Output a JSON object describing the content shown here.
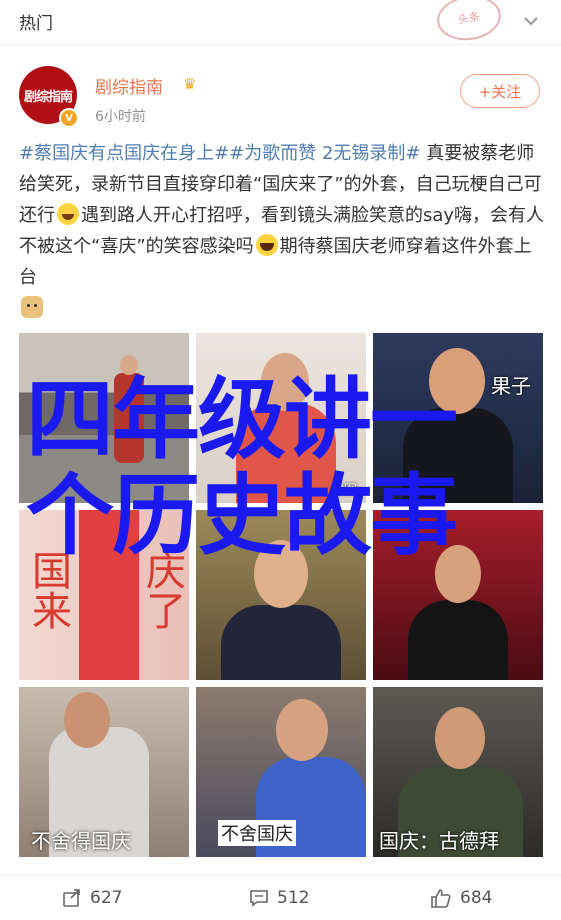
{
  "header": {
    "title": "热门",
    "stamp_text": "头条"
  },
  "author": {
    "name": "剧综指南",
    "avatar_text": "剧综指南",
    "time": "6小时前",
    "follow_label": "+关注",
    "verified_mark": "V"
  },
  "post": {
    "tag1": "#蔡国庆有点国庆在身上#",
    "tag2": "#为歌而赞 2无锡录制#",
    "text1": " 真要被蔡老师给笑死，录新节目直接穿印着“国庆来了”的外套，自己玩梗自己可还行",
    "text2": "遇到路人开心打招呼，看到镜头满脸笑意的say嗨，会有人不被这个“喜庆”的笑容感染吗",
    "text3": "期待蔡国庆老师穿着这件外套上台"
  },
  "images": [
    {
      "caption": ""
    },
    {
      "caption": "动图"
    },
    {
      "caption": "果子"
    },
    {
      "caption": "国来"
    },
    {
      "caption": "庆了"
    },
    {
      "caption": ""
    },
    {
      "caption": ""
    },
    {
      "caption": "不舍得国庆"
    },
    {
      "caption": "不舍国庆"
    },
    {
      "caption": "国庆：古德拜"
    }
  ],
  "overlay": {
    "line1": "四年级讲一",
    "line2": "个历史故事"
  },
  "actions": {
    "repost": "627",
    "comment": "512",
    "like": "684"
  }
}
